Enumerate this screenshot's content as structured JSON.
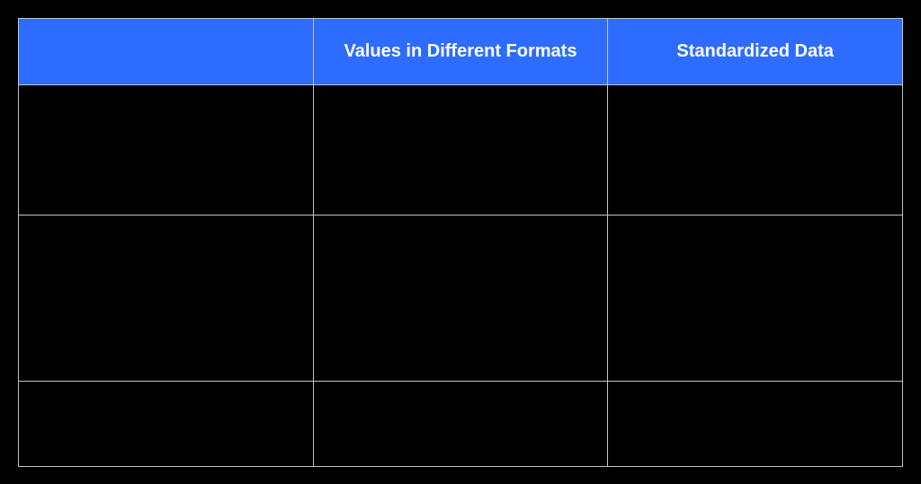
{
  "table": {
    "headers": [
      "",
      "Values in Different Formats",
      "Standardized Data"
    ],
    "rows": [
      [
        "",
        "",
        ""
      ],
      [
        "",
        "",
        ""
      ],
      [
        "",
        "",
        ""
      ]
    ]
  }
}
